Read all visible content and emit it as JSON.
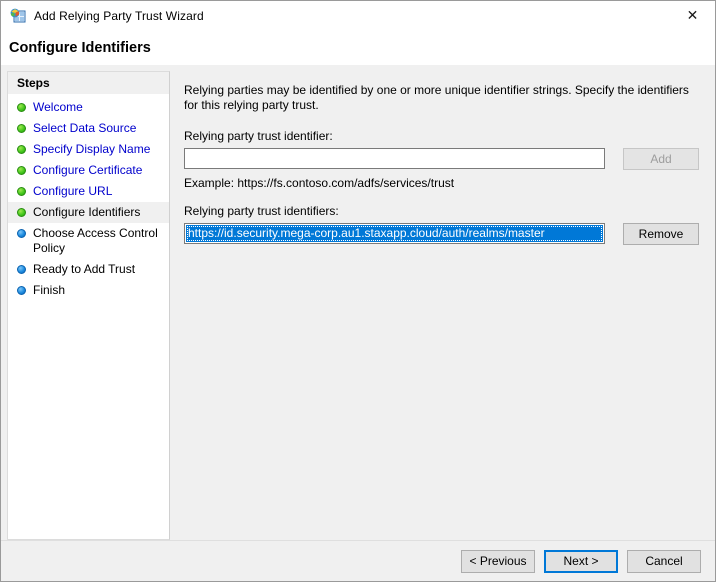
{
  "window": {
    "title": "Add Relying Party Trust Wizard",
    "icon": "wizard-server-icon",
    "close_label": "✕"
  },
  "header": {
    "title": "Configure Identifiers"
  },
  "sidebar": {
    "heading": "Steps",
    "items": [
      {
        "label": "Welcome",
        "state": "done"
      },
      {
        "label": "Select Data Source",
        "state": "done"
      },
      {
        "label": "Specify Display Name",
        "state": "done"
      },
      {
        "label": "Configure Certificate",
        "state": "done"
      },
      {
        "label": "Configure URL",
        "state": "done"
      },
      {
        "label": "Configure Identifiers",
        "state": "current"
      },
      {
        "label": "Choose Access Control Policy",
        "state": "future"
      },
      {
        "label": "Ready to Add Trust",
        "state": "future"
      },
      {
        "label": "Finish",
        "state": "future"
      }
    ]
  },
  "main": {
    "intro": "Relying parties may be identified by one or more unique identifier strings. Specify the identifiers for this relying party trust.",
    "identifier_label": "Relying party trust identifier:",
    "identifier_value": "",
    "identifier_placeholder": "",
    "add_label": "Add",
    "add_enabled": false,
    "example_text": "Example: https://fs.contoso.com/adfs/services/trust",
    "identifiers_label": "Relying party trust identifiers:",
    "remove_label": "Remove",
    "identifiers": [
      "https://id.security.mega-corp.au1.staxapp.cloud/auth/realms/master"
    ]
  },
  "footer": {
    "previous_label": "< Previous",
    "next_label": "Next >",
    "cancel_label": "Cancel"
  },
  "colors": {
    "accent": "#0078d7",
    "step_done": "#46c81e",
    "step_todo": "#1e8ce0",
    "link_text": "#0000cc",
    "chrome": "#f0f0f0"
  }
}
